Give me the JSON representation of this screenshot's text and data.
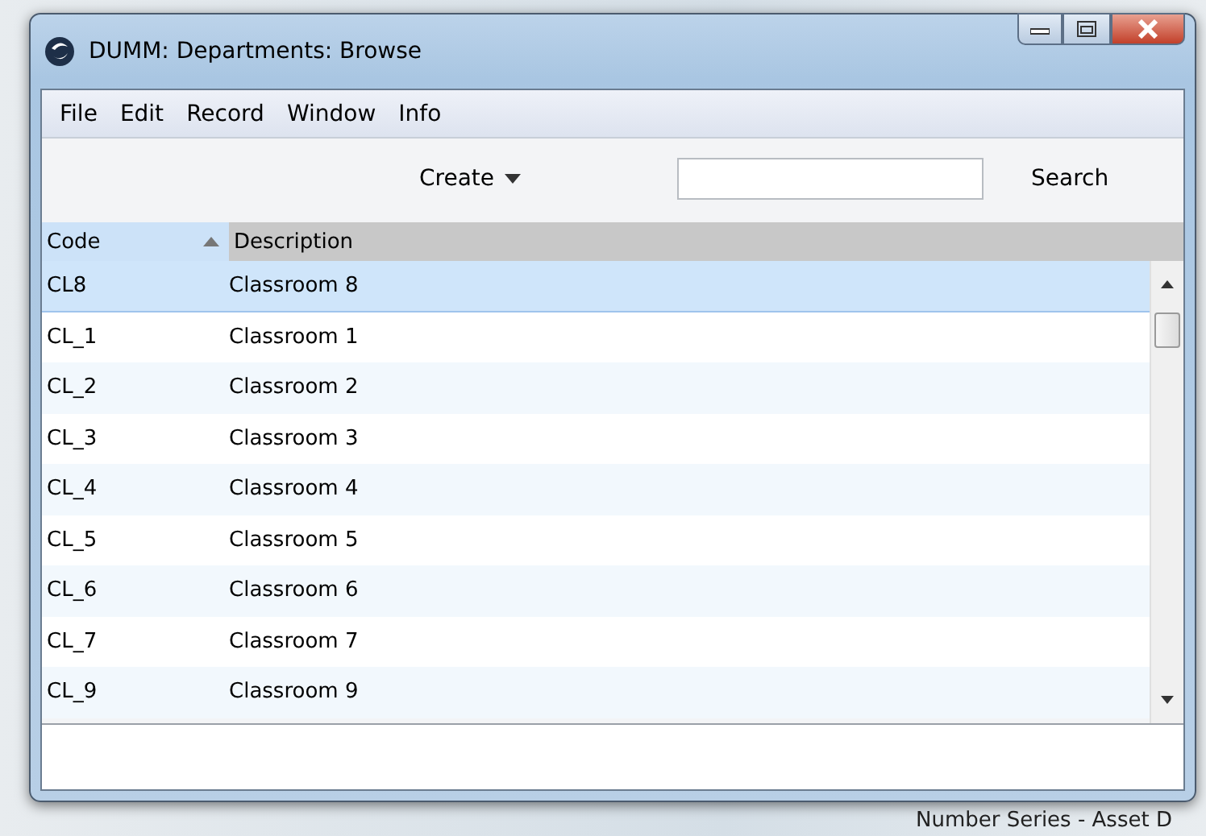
{
  "window": {
    "title": "DUMM: Departments: Browse"
  },
  "menu": [
    "File",
    "Edit",
    "Record",
    "Window",
    "Info"
  ],
  "toolbar": {
    "create_label": "Create",
    "search_label": "Search"
  },
  "table": {
    "columns": [
      {
        "label": "Code",
        "sorted": true
      },
      {
        "label": "Description",
        "sorted": false
      }
    ],
    "rows": [
      {
        "code": "CL8",
        "description": "Classroom 8",
        "selected": true
      },
      {
        "code": "CL_1",
        "description": "Classroom 1",
        "selected": false
      },
      {
        "code": "CL_2",
        "description": "Classroom 2",
        "selected": false
      },
      {
        "code": "CL_3",
        "description": "Classroom 3",
        "selected": false
      },
      {
        "code": "CL_4",
        "description": "Classroom 4",
        "selected": false
      },
      {
        "code": "CL_5",
        "description": "Classroom 5",
        "selected": false
      },
      {
        "code": "CL_6",
        "description": "Classroom 6",
        "selected": false
      },
      {
        "code": "CL_7",
        "description": "Classroom 7",
        "selected": false
      },
      {
        "code": "CL_9",
        "description": "Classroom 9",
        "selected": false
      }
    ]
  },
  "background": {
    "text": "Number Series - Asset D"
  }
}
